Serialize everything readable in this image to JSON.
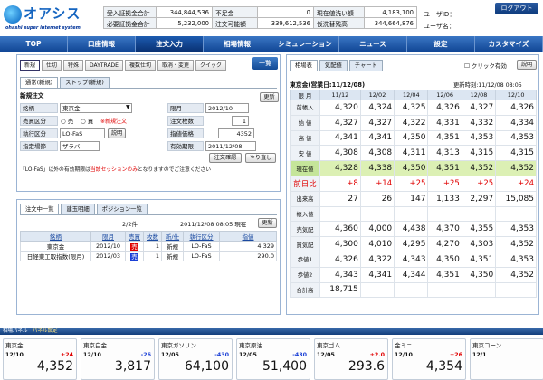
{
  "app": {
    "logo_name": "オアシス",
    "logo_sub": "ohashi super internet system"
  },
  "account": [
    [
      "受入証拠金合計",
      "344,844,536",
      "不足金",
      "0",
      "現在値洗い額",
      "4,183,100"
    ],
    [
      "必要証拠金合計",
      "5,232,000",
      "注文可能額",
      "339,612,536",
      "仮洗替残高",
      "344,664,876"
    ]
  ],
  "user": {
    "id_label": "ユーザID：",
    "name_label": "ユーザ名："
  },
  "logout": "ログアウト",
  "nav": [
    "TOP",
    "口座情報",
    "注文入力",
    "相場情報",
    "シミュレーション",
    "ニュース",
    "設定",
    "カスタマイズ"
  ],
  "order_subtabs": [
    "新規",
    "仕切",
    "特殊",
    "DAYTRADE",
    "複数仕切",
    "取消・変更",
    "クイック"
  ],
  "list_button": "一覧",
  "order_tabs": [
    "通常(新規)",
    "ストップ(新規)"
  ],
  "order_section": "新規注文",
  "form": {
    "meigara_label": "銘柄",
    "meigara_value": "東京金",
    "baibai_label": "売買区分",
    "sell": "売",
    "buy": "買",
    "new_note": "※新規注文",
    "shikkou_label": "執行区分",
    "shikkou_value": "LO-FaS",
    "setsumei": "説明",
    "shitei_label": "指定場節",
    "shitei_value": "ザラバ",
    "genjitsu_label": "限月",
    "genjitsu_value": "2012/10",
    "maisu_label": "注文枚数",
    "maisu_value": "1",
    "price_label": "指値価格",
    "price_value": "4352",
    "yuko_label": "有効期限",
    "yuko_value": "2011/12/08",
    "update": "更新",
    "confirm": "注文確認",
    "reset": "やり直し",
    "note_pre": "「LO-FaS」以外の有効期限は",
    "note_red": "当該セッションのみ",
    "note_post": "となりますのでご注意ください"
  },
  "list_tabs": [
    "注文中一覧",
    "建玉明細",
    "ポジション一覧"
  ],
  "list_info": {
    "pages": "2/2件",
    "datetime": "2011/12/08 08:05 現在",
    "update": "更新"
  },
  "list_headers": [
    "銘柄",
    "限月",
    "売買",
    "枚数",
    "新/仕",
    "執行区分",
    "指値"
  ],
  "list_rows": [
    [
      "東京金",
      "2012/10",
      "売",
      "1",
      "新規",
      "LO-FaS",
      "4,329"
    ],
    [
      "日経東工取指数(限月)",
      "2012/03",
      "売",
      "1",
      "新規",
      "LO-FaS",
      "290.0"
    ]
  ],
  "board_tabs": [
    "相場表",
    "気配値",
    "チャート"
  ],
  "board_click": "クリック有効",
  "board_setsumei": "説明",
  "board_title": "東京金(営業日:11/12/08)",
  "board_update": "更新時刻:11/12/08 08:05",
  "board_months": [
    "限 月",
    "11/12",
    "12/02",
    "12/04",
    "12/06",
    "12/08",
    "12/10"
  ],
  "board_rows": [
    {
      "label": "前帳入",
      "vals": [
        "4,320",
        "4,324",
        "4,325",
        "4,326",
        "4,327",
        "4,326"
      ]
    },
    {
      "label": "始 値",
      "vals": [
        "4,327",
        "4,327",
        "4,322",
        "4,331",
        "4,332",
        "4,334"
      ]
    },
    {
      "label": "高 値",
      "vals": [
        "4,341",
        "4,341",
        "4,350",
        "4,351",
        "4,353",
        "4,353"
      ]
    },
    {
      "label": "安 値",
      "vals": [
        "4,308",
        "4,308",
        "4,311",
        "4,313",
        "4,315",
        "4,315"
      ]
    },
    {
      "label": "現在値",
      "vals": [
        "4,328",
        "4,338",
        "4,350",
        "4,351",
        "4,352",
        "4,352"
      ],
      "cur": true
    },
    {
      "label": "前日比",
      "vals": [
        "+8",
        "+14",
        "+25",
        "+25",
        "+25",
        "+24"
      ],
      "chg": true
    },
    {
      "label": "出来高",
      "vals": [
        "27",
        "26",
        "147",
        "1,133",
        "2,297",
        "15,085"
      ]
    },
    {
      "label": "帳入値",
      "vals": [
        "",
        "",
        "",
        "",
        "",
        ""
      ]
    },
    {
      "label": "売気配",
      "vals": [
        "4,360",
        "4,000",
        "4,438",
        "4,370",
        "4,355",
        "4,353"
      ]
    },
    {
      "label": "買気配",
      "vals": [
        "4,300",
        "4,010",
        "4,295",
        "4,270",
        "4,303",
        "4,352"
      ]
    },
    {
      "label": "歩値1",
      "vals": [
        "4,326",
        "4,322",
        "4,343",
        "4,350",
        "4,351",
        "4,353"
      ]
    },
    {
      "label": "歩値2",
      "vals": [
        "4,343",
        "4,341",
        "4,344",
        "4,351",
        "4,350",
        "4,352"
      ]
    },
    {
      "label": "合計高",
      "vals": [
        "18,715",
        "",
        "",
        "",
        "",
        ""
      ]
    }
  ],
  "ticker_title": "相場パネル",
  "ticker_set": "パネル設定",
  "tickers": [
    {
      "name": "東京金",
      "month": "12/10",
      "change": "+24",
      "price": "4,352",
      "dir": "up"
    },
    {
      "name": "東京白金",
      "month": "12/10",
      "change": "-26",
      "price": "3,817",
      "dir": "dn"
    },
    {
      "name": "東京ガソリン",
      "month": "12/05",
      "change": "-430",
      "price": "64,100",
      "dir": "dn"
    },
    {
      "name": "東京原油",
      "month": "12/05",
      "change": "-430",
      "price": "51,400",
      "dir": "dn"
    },
    {
      "name": "東京ゴム",
      "month": "12/05",
      "change": "+2.0",
      "price": "293.6",
      "dir": "up"
    },
    {
      "name": "金ミニ",
      "month": "12/10",
      "change": "+26",
      "price": "4,354",
      "dir": "up"
    },
    {
      "name": "東京コーン",
      "month": "12/1",
      "change": "",
      "price": "",
      "dir": "up"
    }
  ],
  "colors": {
    "up": "#e00000",
    "down": "#1a3fd6",
    "nav": "#1a4fa0",
    "current_row": "#dcf0b4"
  }
}
